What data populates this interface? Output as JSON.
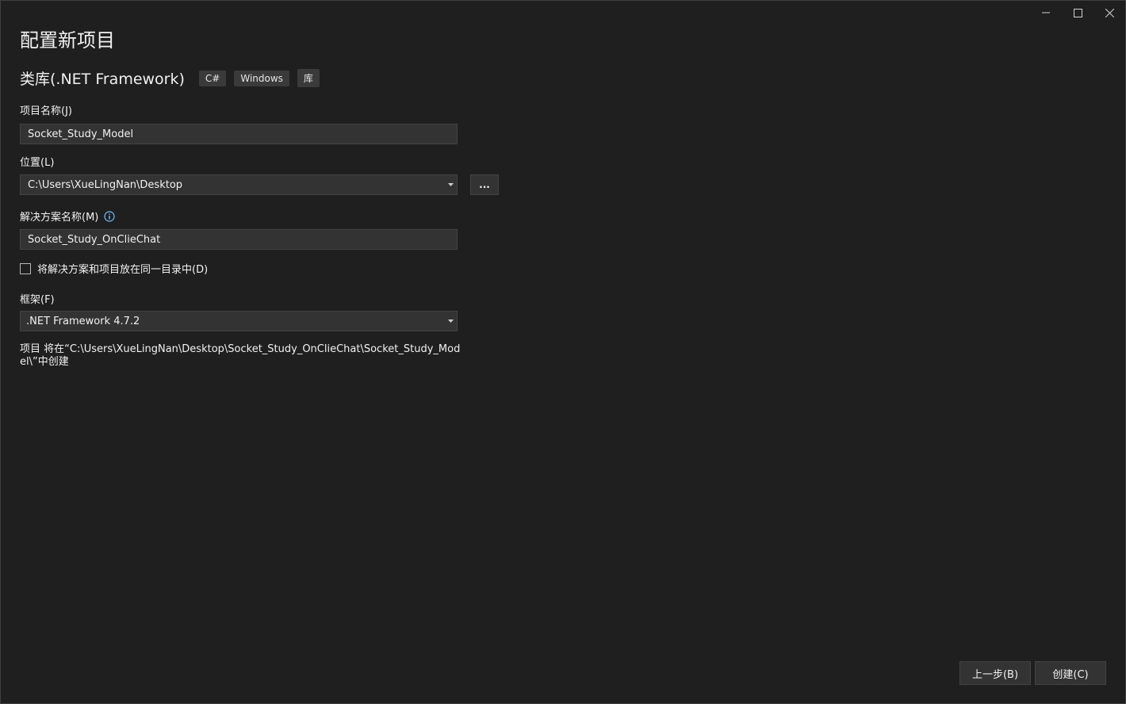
{
  "title": "配置新项目",
  "template": {
    "name": "类库(.NET Framework)",
    "tags": [
      "C#",
      "Windows",
      "库"
    ]
  },
  "project_name": {
    "label": "项目名称(J)",
    "value": "Socket_Study_Model"
  },
  "location": {
    "label": "位置(L)",
    "value": "C:\\Users\\XueLingNan\\Desktop",
    "browse_label": "..."
  },
  "solution_name": {
    "label": "解决方案名称(M)",
    "value": "Socket_Study_OnClieChat"
  },
  "same_directory": {
    "label": "将解决方案和项目放在同一目录中(D)",
    "checked": false
  },
  "framework": {
    "label": "框架(F)",
    "value": ".NET Framework 4.7.2"
  },
  "path_note": "项目 将在“C:\\Users\\XueLingNan\\Desktop\\Socket_Study_OnClieChat\\Socket_Study_Model\\”中创建",
  "buttons": {
    "back": "上一步(B)",
    "create": "创建(C)"
  }
}
